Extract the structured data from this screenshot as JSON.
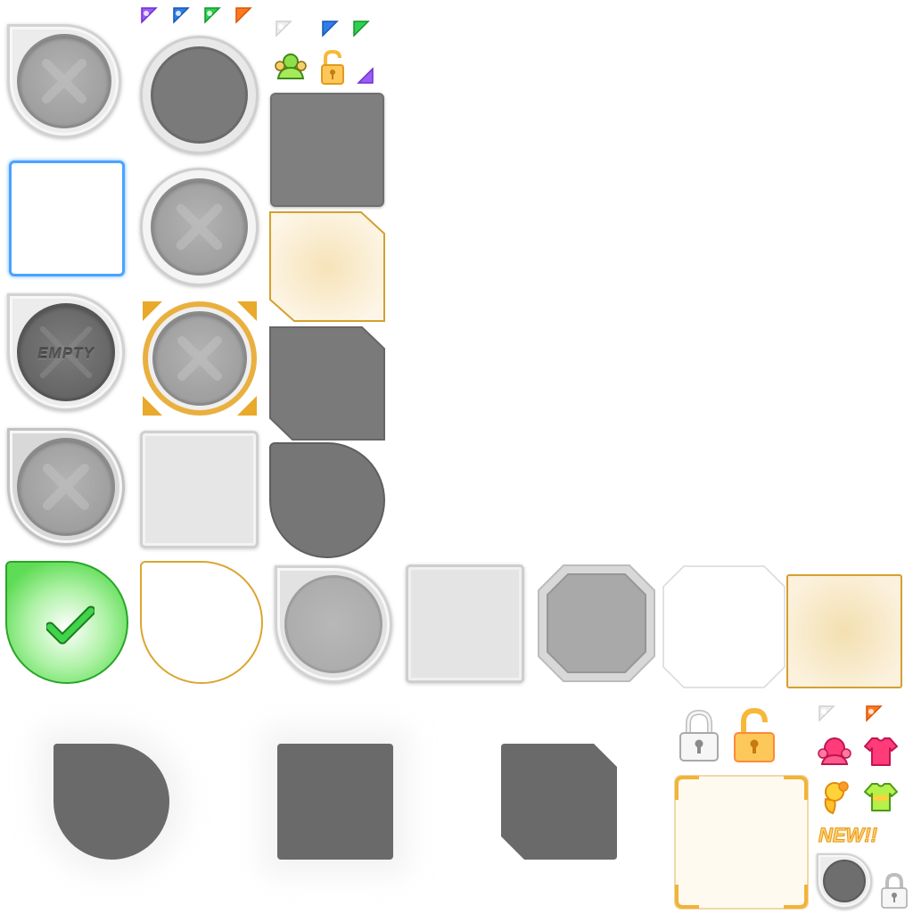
{
  "slots": {
    "empty_label": "EMPTY",
    "new_label": "NEW!!"
  },
  "colors": {
    "purple_tab": "#9b5cf5",
    "blue_tab": "#2f7de8",
    "green_tab": "#2ed14f",
    "orange_tab": "#ff7a1e",
    "gray_tab": "#d4d4d4",
    "gold_frame": "#e9a92b",
    "blue_select": "#4aa3ff",
    "green_check": "#3fd449",
    "lock_gold": "#f7b83a",
    "lock_silver": "#f2f2f2",
    "dark_slot": "#6a6a6a"
  },
  "icons": [
    "purple-corner-tab-icon",
    "blue-corner-tab-icon",
    "green-corner-tab-icon",
    "orange-corner-tab-icon",
    "gray-corner-tab-icon",
    "friends-icon",
    "unlocked-padlock-icon",
    "locked-padlock-icon",
    "checkmark-icon",
    "pink-head-icon",
    "pink-shirt-icon",
    "yellow-head-icon",
    "green-shirt-icon"
  ]
}
